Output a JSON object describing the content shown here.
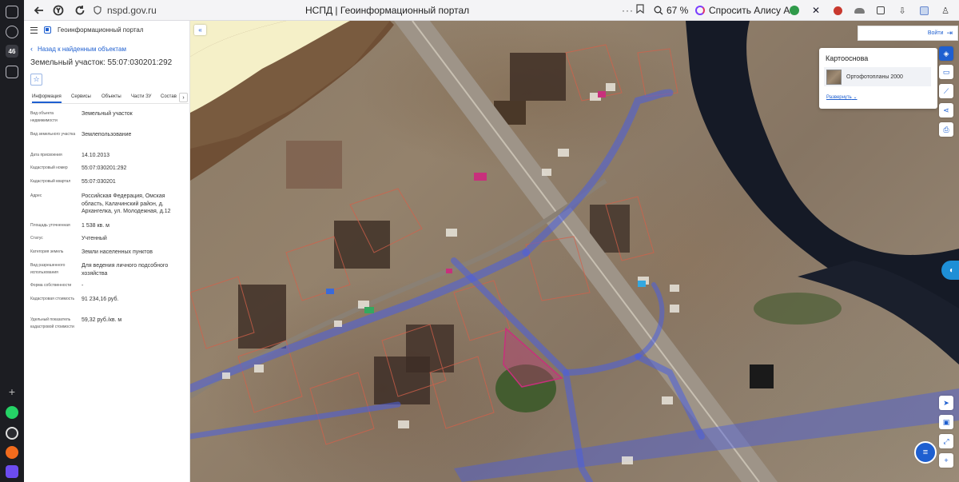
{
  "browser": {
    "url": "nspd.gov.ru",
    "tab_title": "НСПД | Геоинформационный портал",
    "zoom": "67 %",
    "alice_label": "Спросить Алису AI",
    "dock_badge": "46"
  },
  "panel": {
    "portal_name": "Геоинформационный портал",
    "back_label": "Назад к найденным объектам",
    "object_title": "Земельный участок: 55:07:030201:292",
    "tabs": [
      {
        "label": "Информация"
      },
      {
        "label": "Сервисы"
      },
      {
        "label": "Объекты"
      },
      {
        "label": "Части ЗУ"
      },
      {
        "label": "Состав"
      }
    ],
    "props": [
      {
        "key": "Вид объекта недвижимости",
        "value": "Земельный участок"
      },
      {
        "key": "Вид земельного участка",
        "value": "Землепользование"
      },
      {
        "key": "Дата присвоения",
        "value": "14.10.2013"
      },
      {
        "key": "Кадастровый номер",
        "value": "55:07:030201:292"
      },
      {
        "key": "Кадастровый квартал",
        "value": "55:07:030201"
      },
      {
        "key": "Адрес",
        "value": "Российская Федерация, Омская область, Калачинский район, д. Архангелка, ул. Молодежная, д.12"
      },
      {
        "key": "Площадь уточненная",
        "value": "1 538 кв. м"
      },
      {
        "key": "Статус",
        "value": "Учтенный"
      },
      {
        "key": "Категория земель",
        "value": "Земли населенных пунктов"
      },
      {
        "key": "Вид разрешенного использования",
        "value": "Для ведения личного подсобного хозяйства"
      },
      {
        "key": "Форма собственности",
        "value": "-"
      },
      {
        "key": "Кадастровая стоимость",
        "value": "91 234,16 руб."
      },
      {
        "key": "Удельный показатель кадастровой стоимости",
        "value": "59,32 руб./кв. м"
      }
    ]
  },
  "map": {
    "login_label": "Войти",
    "basemap_title": "Картооснова",
    "basemap_layer": "Ортофотопланы 2000",
    "expand_label": "Развернуть"
  },
  "colors": {
    "accent": "#1e5fd0",
    "highlight_parcel": "#c8307c",
    "utility_lines": "#4a5ee0"
  }
}
